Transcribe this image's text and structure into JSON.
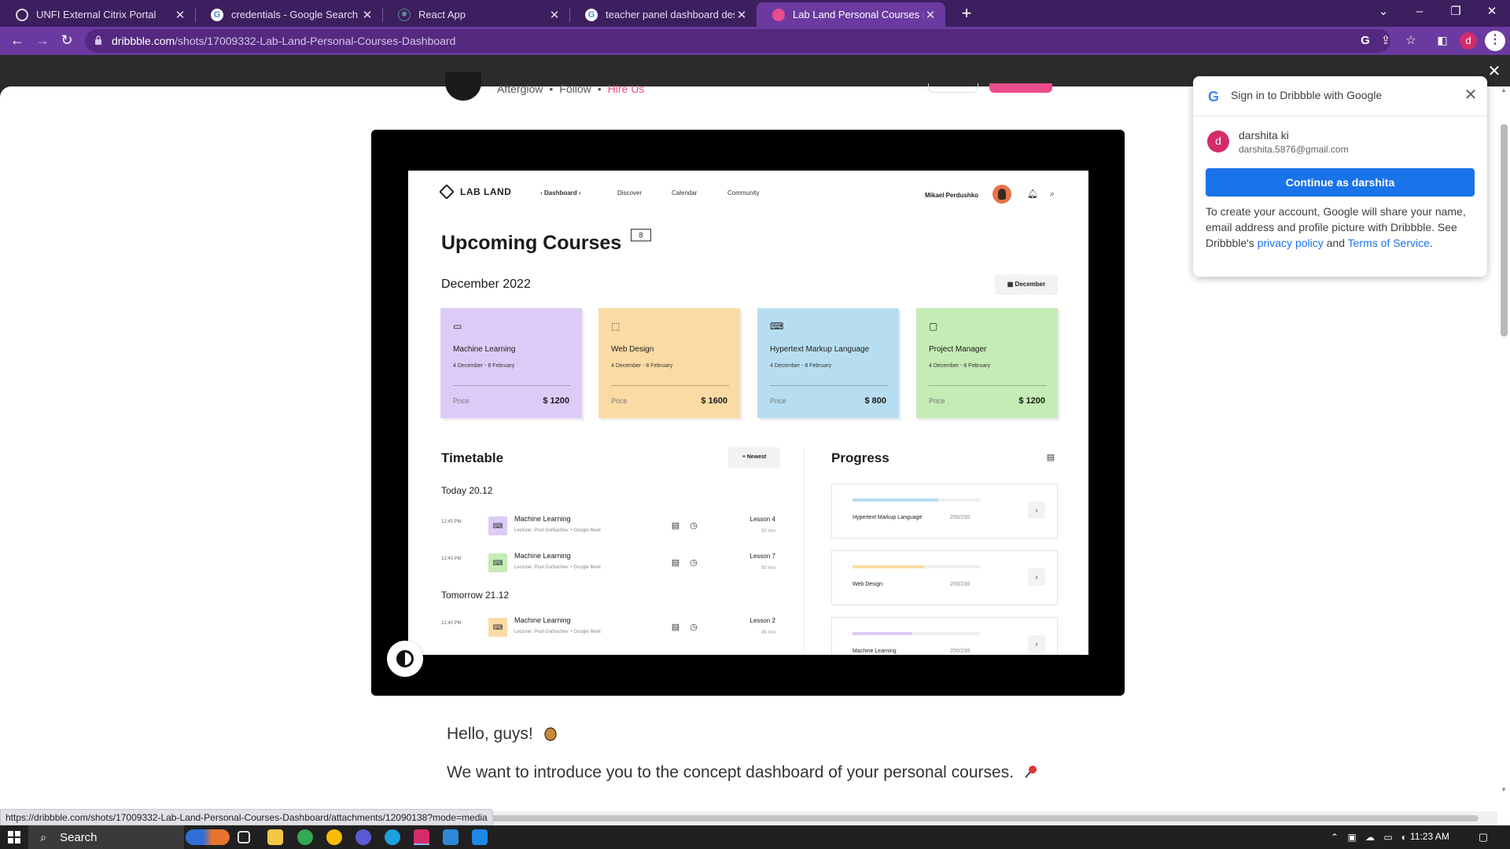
{
  "browser": {
    "tabs": [
      {
        "title": "UNFI External Citrix Portal",
        "favicon": "citrix-icon",
        "active": false
      },
      {
        "title": "credentials - Google Search",
        "favicon": "google-icon",
        "active": false
      },
      {
        "title": "React App",
        "favicon": "react-icon",
        "active": false
      },
      {
        "title": "teacher panel dashboard design",
        "favicon": "google-icon",
        "active": false
      },
      {
        "title": "Lab Land Personal Courses Dashb",
        "favicon": "dribbble-icon",
        "active": true
      }
    ],
    "new_tab": "+",
    "url_host": "dribbble.com",
    "url_path": "/shots/17009332-Lab-Land-Personal-Courses-Dashboard",
    "profile_initial": "d",
    "accent_color": "#6b3aa0"
  },
  "shot_header": {
    "author": "Afterglow",
    "follow": "Follow",
    "hire": "Hire Us"
  },
  "design": {
    "logo": "LAB LAND",
    "nav": [
      "› Dashboard ‹",
      "Discover",
      "Calendar",
      "Community"
    ],
    "user": "Mikael Perdushko",
    "title": "Upcoming Courses",
    "count": "8",
    "month": "December 2022",
    "month_button": "December",
    "courses": [
      {
        "name": "Machine Learning",
        "dates": "4 December - 8 February",
        "price_label": "Price",
        "price": "$ 1200",
        "color": "#dccbf7",
        "icon": "monitor-icon"
      },
      {
        "name": "Web Design",
        "dates": "4 December - 8 February",
        "price_label": "Price",
        "price": "$ 1600",
        "color": "#fbdba4",
        "icon": "cursor-icon"
      },
      {
        "name": "Hypertext Markup Language",
        "dates": "4 December - 8 February",
        "price_label": "Price",
        "price": "$ 800",
        "color": "#b7def0",
        "icon": "code-icon"
      },
      {
        "name": "Project Manager",
        "dates": "4 December - 8 February",
        "price_label": "Price",
        "price": "$ 1200",
        "color": "#c4ecb4",
        "icon": "chat-icon"
      }
    ],
    "timetable": {
      "title": "Timetable",
      "filter": "Newest",
      "days": [
        {
          "label": "Today 20.12",
          "rows": [
            {
              "time": "12:40 PM",
              "course": "Machine Learning",
              "lecturer": "Lecturer: Poul Gorbachev",
              "platform": "Google Meet",
              "lesson": "Lesson 4",
              "duration": "50 min",
              "badge_color": "#dccbf7"
            },
            {
              "time": "12:40 PM",
              "course": "Machine Learning",
              "lecturer": "Lecturer: Poul Gorbachev",
              "platform": "Google Meet",
              "lesson": "Lesson 7",
              "duration": "90 min",
              "badge_color": "#c4ecb4"
            }
          ]
        },
        {
          "label": "Tomorrow 21.12",
          "rows": [
            {
              "time": "12:40 PM",
              "course": "Machine Learning",
              "lecturer": "Lecturer: Poul Gorbachev",
              "platform": "Google Meet",
              "lesson": "Lesson 2",
              "duration": "45 min",
              "badge_color": "#fbdba4"
            }
          ]
        }
      ]
    },
    "progress": {
      "title": "Progress",
      "items": [
        {
          "name": "Hypertext Markup Language",
          "count": "200/230",
          "fraction": 0.67,
          "color": "#b7def0"
        },
        {
          "name": "Web Design",
          "count": "200/230",
          "fraction": 0.56,
          "color": "#fbdba4"
        },
        {
          "name": "Machine Learning",
          "count": "200/230",
          "fraction": 0.47,
          "color": "#dccbf7"
        }
      ]
    }
  },
  "description": {
    "line1": "Hello, guys!",
    "line2": "We want to introduce you to the concept dashboard of your personal courses."
  },
  "google_signin": {
    "title": "Sign in to Dribbble with Google",
    "account_initial": "d",
    "account_name": "darshita ki",
    "account_email": "darshita.5876@gmail.com",
    "continue_label": "Continue as darshita",
    "text_before": "To create your account, Google will share your name, email address and profile picture with Dribbble. See Dribbble's",
    "privacy_link": "privacy policy",
    "and": "and",
    "terms_link": "Terms of Service",
    "period": "."
  },
  "status_url": "https://dribbble.com/shots/17009332-Lab-Land-Personal-Courses-Dashboard/attachments/12090138?mode=media",
  "taskbar": {
    "search_label": "Search",
    "time": "11:23 AM"
  }
}
